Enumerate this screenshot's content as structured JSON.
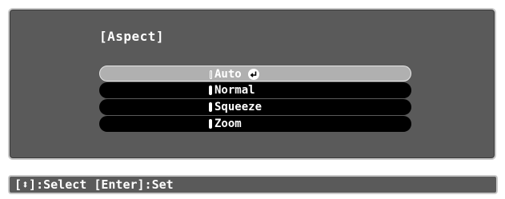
{
  "menu": {
    "title": "[Aspect]",
    "options": [
      {
        "label": "Auto",
        "selected": true,
        "has_enter_icon": true
      },
      {
        "label": "Normal",
        "selected": false
      },
      {
        "label": "Squeeze",
        "selected": false
      },
      {
        "label": "Zoom",
        "selected": false
      }
    ]
  },
  "help_bar": {
    "text": "[⬍]:Select [Enter]:Set"
  },
  "icons": {
    "enter": "enter-icon",
    "radio": "radio-mark-icon"
  },
  "colors": {
    "panel": "#5a5a5a",
    "panel_border": "#c8c8c8",
    "option_bg": "#000000",
    "selected_bg": "#b0b0b0",
    "text": "#ffffff"
  }
}
